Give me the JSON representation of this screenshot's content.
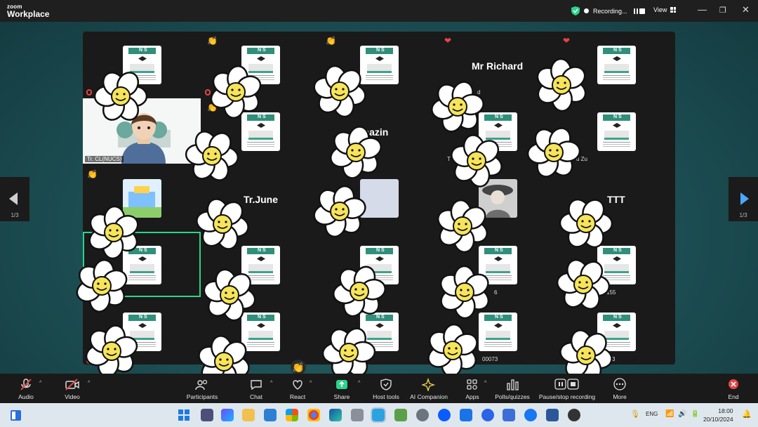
{
  "app": {
    "brand_small": "zoom",
    "brand_big": "Workplace"
  },
  "titlebar": {
    "recording_label": "Recording...",
    "view_label": "View"
  },
  "page_indicator": {
    "left": "1/3",
    "right": "1/3"
  },
  "participants": {
    "names": [
      "Mr Richard",
      "Thazin",
      "Tr.June",
      "TTT"
    ],
    "labels": [
      "S",
      "d",
      "Tr. CL(NUCS)",
      "T",
      "u Zu",
      "6",
      "155",
      "00073",
      "3"
    ]
  },
  "toolbar": {
    "audio": "Audio",
    "video": "Video",
    "participants": "Participants",
    "chat": "Chat",
    "react": "React",
    "share": "Share",
    "host_tools": "Host tools",
    "ai_companion": "AI Companion",
    "apps": "Apps",
    "polls": "Polls/quizzes",
    "pause_recording": "Pause/stop recording",
    "more": "More",
    "end": "End"
  },
  "taskbar": {
    "lang": "ENG",
    "time": "18:00",
    "date": "20/10/2024"
  },
  "colors": {
    "accent_green": "#2bd48a",
    "record_red": "#e64646",
    "tile_bg": "#1a1a1a"
  }
}
